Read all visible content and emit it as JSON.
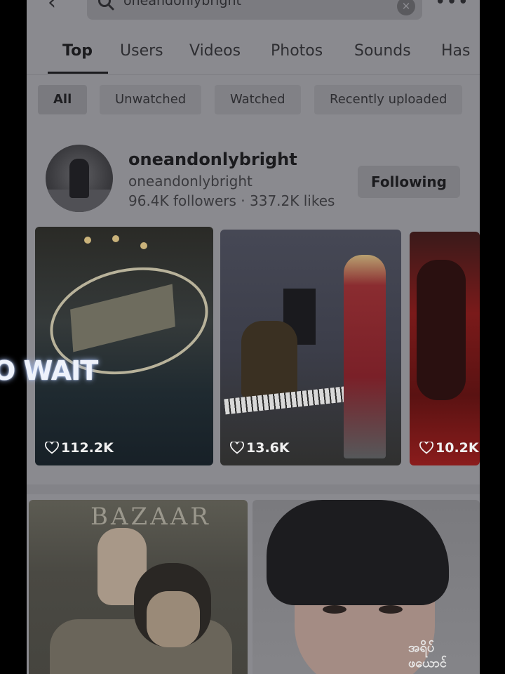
{
  "search": {
    "query": "oneandonlybright"
  },
  "tabs": [
    {
      "label": "Top",
      "active": true
    },
    {
      "label": "Users"
    },
    {
      "label": "Videos"
    },
    {
      "label": "Photos"
    },
    {
      "label": "Sounds"
    },
    {
      "label": "Has"
    }
  ],
  "filters": [
    {
      "label": "All",
      "active": true
    },
    {
      "label": "Unwatched"
    },
    {
      "label": "Watched"
    },
    {
      "label": "Recently uploaded"
    }
  ],
  "user": {
    "name": "oneandonlybright",
    "handle": "oneandonlybright",
    "stats": "96.4K followers · 337.2K likes",
    "follow_label": "Following"
  },
  "videos": [
    {
      "likes": "112.2K"
    },
    {
      "likes": "13.6K"
    },
    {
      "likes": "10.2K"
    }
  ],
  "photos": [
    {
      "text": "BAZAAR"
    },
    {
      "caption_line1": "အရိပ်",
      "caption_line2": "ဖယောင်"
    }
  ],
  "overlay": {
    "text": "O WAIT"
  },
  "colors": {
    "page_dimmed": "#8a8a8f",
    "background": "#000000",
    "overlay_glow": "#9fb6e8"
  },
  "icons": {
    "back": "back-arrow-icon",
    "search": "search-icon",
    "clear": "clear-icon",
    "more": "more-icon",
    "like": "heart-icon"
  }
}
